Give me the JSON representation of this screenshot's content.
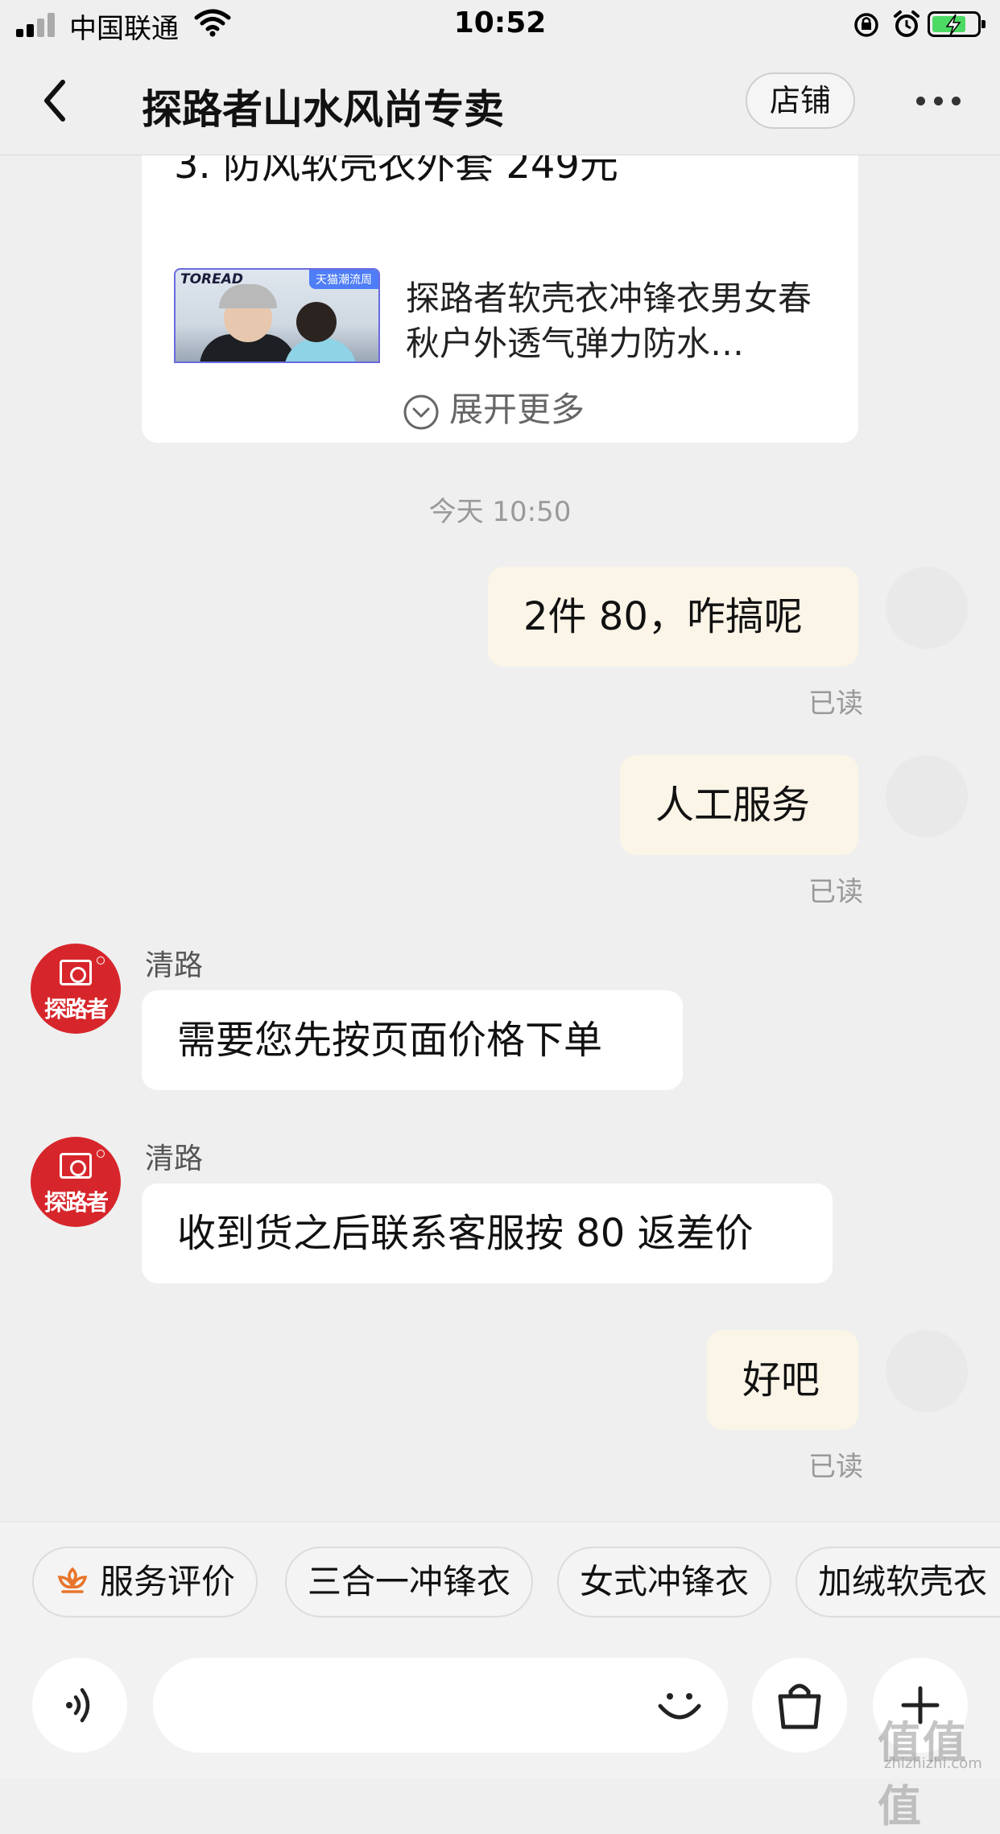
{
  "status_bar": {
    "carrier": "中国联通",
    "time": "10:52",
    "battery_level": 0.75,
    "battery_color": "#4cd964"
  },
  "nav": {
    "back_icon": "chevron-left-icon",
    "title": "探路者山水风尚专卖",
    "shop_label": "店铺",
    "more_icon": "more-dots-icon"
  },
  "product_card": {
    "cut_text": "3. 防风软壳衣外套 249元",
    "thumb_brand": "TOREAD",
    "thumb_tag": "天猫潮流周",
    "product_name": "探路者软壳衣冲锋衣男女春秋户外透气弹力防水…",
    "expand_label": "展开更多"
  },
  "timestamp": "今天 10:50",
  "messages": [
    {
      "from": "me",
      "text": "2件 80，咋搞呢",
      "status": "已读"
    },
    {
      "from": "me",
      "text": "人工服务",
      "status": "已读"
    },
    {
      "from": "shop",
      "sender": "清路",
      "text": "需要您先按页面价格下单"
    },
    {
      "from": "shop",
      "sender": "清路",
      "text": "收到货之后联系客服按 80 返差价"
    },
    {
      "from": "me",
      "text": "好吧",
      "status": "已读"
    }
  ],
  "shop_avatar_text": "探路者",
  "quick_replies": [
    "服务评价",
    "三合一冲锋衣",
    "女式冲锋衣",
    "加绒软壳衣"
  ],
  "input": {
    "placeholder": "",
    "voice_icon": "voice-icon",
    "emoji_icon": "emoji-icon",
    "bag_icon": "shopping-bag-icon",
    "plus_icon": "plus-icon"
  },
  "watermark": {
    "text": "值值值",
    "url": "zhizhizhi.com"
  },
  "colors": {
    "background": "#efefef",
    "my_bubble": "#fbf5e8",
    "shop_bubble": "#ffffff",
    "shop_avatar": "#d7262b",
    "service_icon": "#e8742a"
  }
}
